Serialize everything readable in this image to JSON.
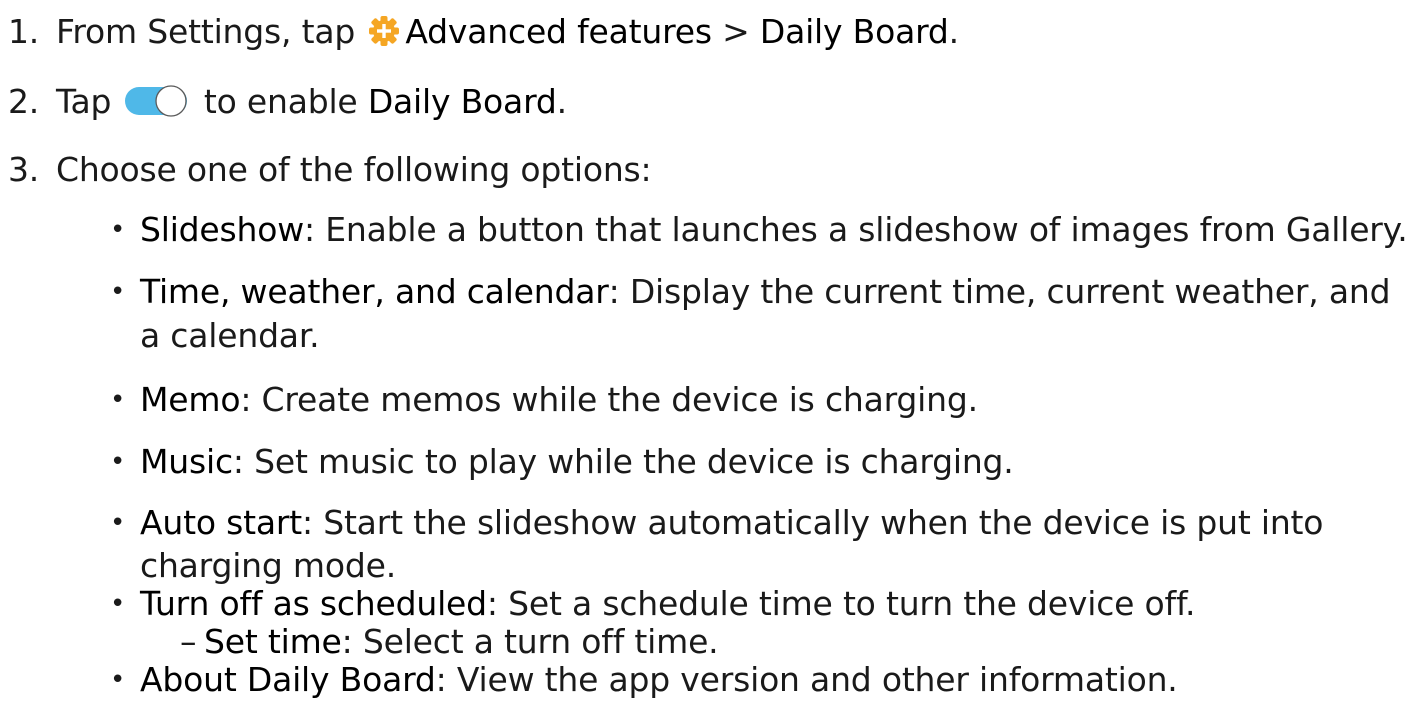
{
  "steps": [
    {
      "number": "1.",
      "text_before": "From Settings, tap ",
      "icon": "advanced-features-icon",
      "term1": "Advanced features",
      "separator": " > ",
      "term2": "Daily Board",
      "text_after": "."
    },
    {
      "number": "2.",
      "text_before": "Tap ",
      "icon": "toggle-switch-icon",
      "text_mid": " to enable ",
      "term": "Daily Board",
      "text_after": "."
    },
    {
      "number": "3.",
      "text": "Choose one of the following options:"
    }
  ],
  "options": [
    {
      "term": "Slideshow",
      "desc_line1": ": Enable a button that launches a slideshow of images from Gallery."
    },
    {
      "term": "Time, weather, and calendar",
      "desc_line1": ": Display the current time, current weather, and",
      "desc_line2": "a calendar."
    },
    {
      "term": "Memo",
      "desc_line1": ": Create memos while the device is charging."
    },
    {
      "term": "Music",
      "desc_line1": ": Set music to play while the device is charging."
    },
    {
      "term": "Auto start",
      "desc_line1": ": Start the slideshow automatically when the device is put into",
      "desc_line2": "charging mode."
    },
    {
      "term": "Turn off as scheduled",
      "desc_line1": ": Set a schedule time to turn the device off."
    },
    {
      "term": "About Daily Board",
      "desc_line1": ": View the app version and other information."
    }
  ],
  "suboption": {
    "dash": "–",
    "term": "Set time",
    "desc": ": Select a turn off time."
  },
  "bullet_char": "•",
  "colors": {
    "gear_orange": "#f5a623",
    "toggle_blue": "#4fb8e8",
    "text": "#1a1a1a"
  }
}
